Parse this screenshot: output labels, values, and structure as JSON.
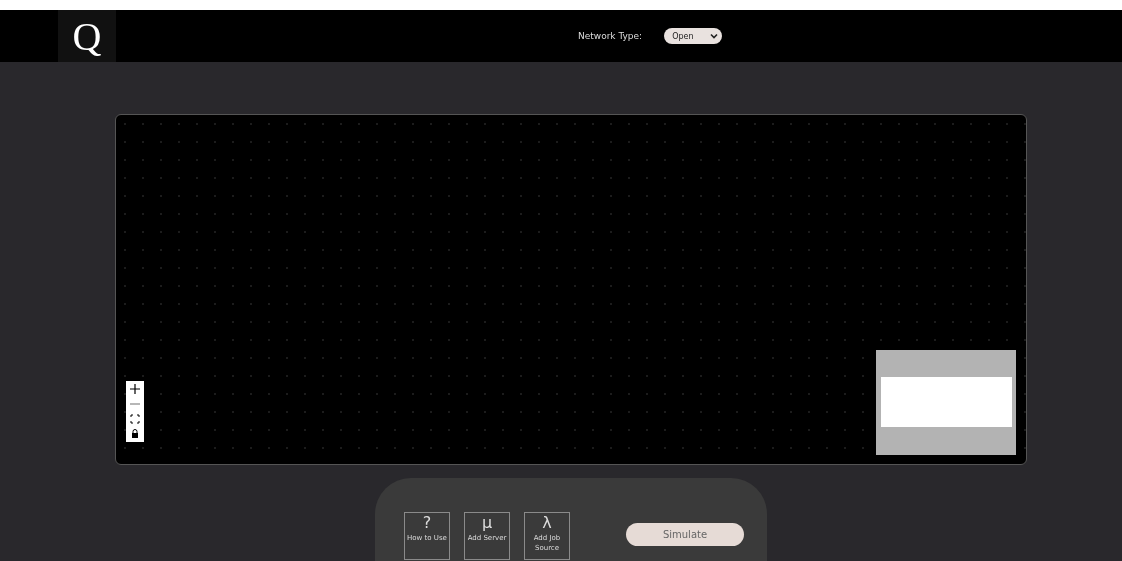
{
  "header": {
    "logo": "Q",
    "network_type": {
      "label": "Network Type:",
      "value": "Open"
    }
  },
  "toolbar": {
    "tools": [
      {
        "symbol": "?",
        "label": "How to Use"
      },
      {
        "symbol": "μ",
        "label": "Add Server"
      },
      {
        "symbol": "λ",
        "label": "Add Job Source"
      }
    ],
    "simulate": "Simulate"
  }
}
